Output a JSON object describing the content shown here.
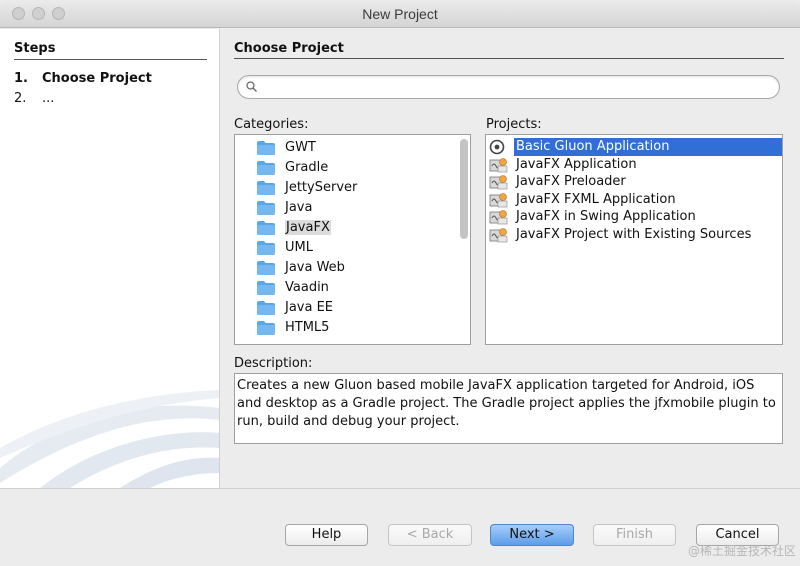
{
  "window": {
    "title": "New Project"
  },
  "steps": {
    "title": "Steps",
    "items": [
      {
        "num": "1.",
        "label": "Choose Project"
      },
      {
        "num": "2.",
        "label": "..."
      }
    ]
  },
  "main": {
    "title": "Choose Project",
    "search": {
      "value": "",
      "placeholder": ""
    },
    "categories_label": "Categories:",
    "projects_label": "Projects:",
    "description_label": "Description:"
  },
  "categories": [
    {
      "label": "GWT",
      "selected": false
    },
    {
      "label": "Gradle",
      "selected": false
    },
    {
      "label": "JettyServer",
      "selected": false
    },
    {
      "label": "Java",
      "selected": false
    },
    {
      "label": "JavaFX",
      "selected": true
    },
    {
      "label": "UML",
      "selected": false
    },
    {
      "label": "Java Web",
      "selected": false
    },
    {
      "label": "Vaadin",
      "selected": false
    },
    {
      "label": "Java EE",
      "selected": false
    },
    {
      "label": "HTML5",
      "selected": false
    }
  ],
  "projects": [
    {
      "label": "Basic Gluon Application",
      "icon": "gluon-icon",
      "selected": true
    },
    {
      "label": "JavaFX Application",
      "icon": "javafx-project-icon",
      "selected": false
    },
    {
      "label": "JavaFX Preloader",
      "icon": "javafx-project-icon",
      "selected": false
    },
    {
      "label": "JavaFX FXML Application",
      "icon": "javafx-project-icon",
      "selected": false
    },
    {
      "label": "JavaFX in Swing Application",
      "icon": "javafx-project-icon",
      "selected": false
    },
    {
      "label": "JavaFX Project with Existing Sources",
      "icon": "javafx-project-icon",
      "selected": false
    }
  ],
  "description": "Creates a new Gluon based mobile JavaFX application targeted for Android, iOS and desktop as a Gradle project. The Gradle project applies the jfxmobile plugin to run, build and debug your project.",
  "buttons": {
    "help": "Help",
    "back": "< Back",
    "next": "Next >",
    "finish": "Finish",
    "cancel": "Cancel"
  },
  "watermark": "@稀土掘金技术社区",
  "colors": {
    "selection": "#2f6fd6",
    "folder": "#5aa6e6",
    "default_button": "#5c9de9"
  }
}
